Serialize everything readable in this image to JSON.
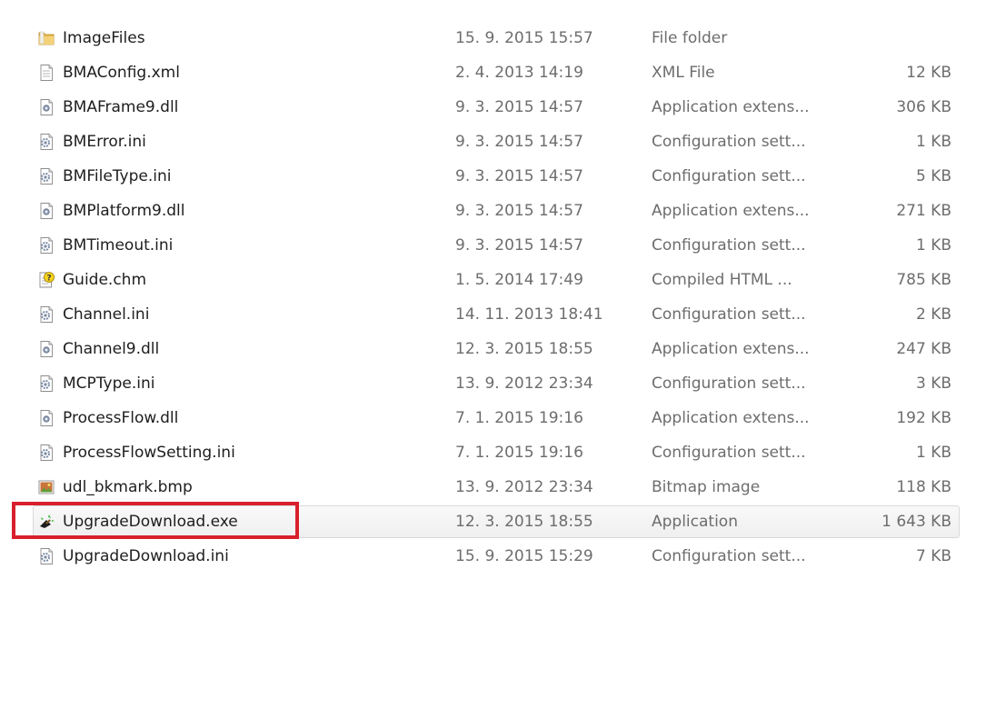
{
  "files": [
    {
      "name": "ImageFiles",
      "date": "15. 9. 2015 15:57",
      "type": "File folder",
      "size": "",
      "icon": "folder-icon"
    },
    {
      "name": "BMAConfig.xml",
      "date": "2. 4. 2013 14:19",
      "type": "XML File",
      "size": "12 KB",
      "icon": "xml-file-icon"
    },
    {
      "name": "BMAFrame9.dll",
      "date": "9. 3. 2015 14:57",
      "type": "Application extens...",
      "size": "306 KB",
      "icon": "dll-file-icon"
    },
    {
      "name": "BMError.ini",
      "date": "9. 3. 2015 14:57",
      "type": "Configuration sett...",
      "size": "1 KB",
      "icon": "ini-file-icon"
    },
    {
      "name": "BMFileType.ini",
      "date": "9. 3. 2015 14:57",
      "type": "Configuration sett...",
      "size": "5 KB",
      "icon": "ini-file-icon"
    },
    {
      "name": "BMPlatform9.dll",
      "date": "9. 3. 2015 14:57",
      "type": "Application extens...",
      "size": "271 KB",
      "icon": "dll-file-icon"
    },
    {
      "name": "BMTimeout.ini",
      "date": "9. 3. 2015 14:57",
      "type": "Configuration sett...",
      "size": "1 KB",
      "icon": "ini-file-icon"
    },
    {
      "name": "Guide.chm",
      "date": "1. 5. 2014 17:49",
      "type": "Compiled HTML ...",
      "size": "785 KB",
      "icon": "chm-help-icon"
    },
    {
      "name": "Channel.ini",
      "date": "14. 11. 2013 18:41",
      "type": "Configuration sett...",
      "size": "2 KB",
      "icon": "ini-file-icon"
    },
    {
      "name": "Channel9.dll",
      "date": "12. 3. 2015 18:55",
      "type": "Application extens...",
      "size": "247 KB",
      "icon": "dll-file-icon"
    },
    {
      "name": "MCPType.ini",
      "date": "13. 9. 2012 23:34",
      "type": "Configuration sett...",
      "size": "3 KB",
      "icon": "ini-file-icon"
    },
    {
      "name": "ProcessFlow.dll",
      "date": "7. 1. 2015 19:16",
      "type": "Application extens...",
      "size": "192 KB",
      "icon": "dll-file-icon"
    },
    {
      "name": "ProcessFlowSetting.ini",
      "date": "7. 1. 2015 19:16",
      "type": "Configuration sett...",
      "size": "1 KB",
      "icon": "ini-file-icon"
    },
    {
      "name": "udl_bkmark.bmp",
      "date": "13. 9. 2012 23:34",
      "type": "Bitmap image",
      "size": "118 KB",
      "icon": "bitmap-image-icon"
    },
    {
      "name": "UpgradeDownload.exe",
      "date": "12. 3. 2015 18:55",
      "type": "Application",
      "size": "1 643 KB",
      "icon": "exe-app-icon",
      "selected": true
    },
    {
      "name": "UpgradeDownload.ini",
      "date": "15. 9. 2015 15:29",
      "type": "Configuration sett...",
      "size": "7 KB",
      "icon": "ini-file-icon"
    }
  ],
  "colors": {
    "highlight_border": "#d8202c",
    "secondary_text": "#6d6d6d",
    "primary_text": "#1e1e1e",
    "selected_row_bg": "#f2f2f2"
  }
}
